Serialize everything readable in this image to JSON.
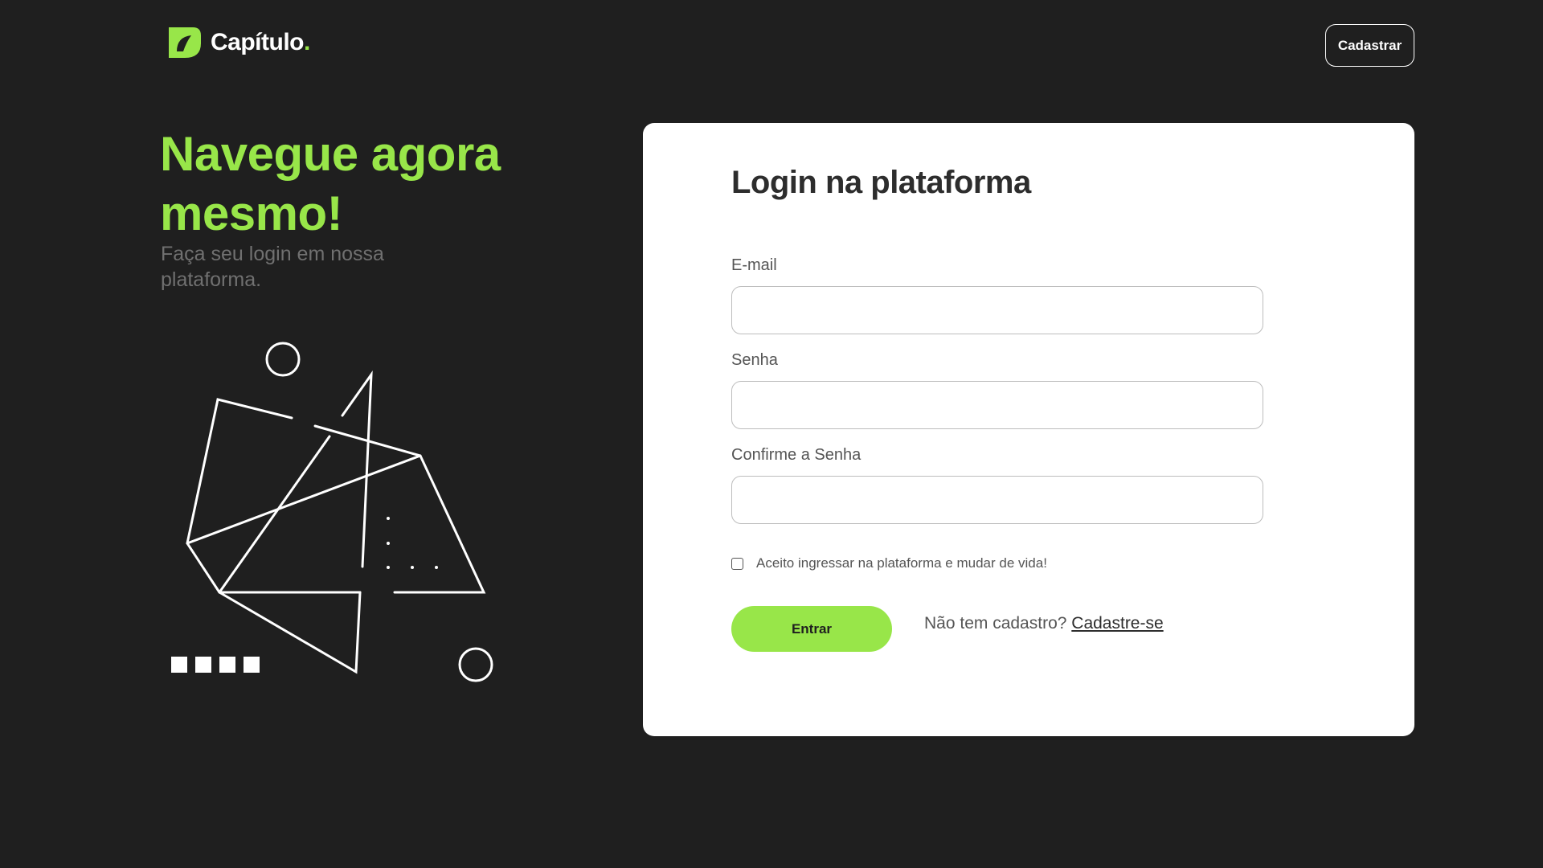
{
  "header": {
    "logo_text": "Capítulo",
    "logo_dot": ".",
    "signup_button": "Cadastrar"
  },
  "hero": {
    "title": "Navegue agora mesmo!",
    "subtitle": "Faça seu login em nossa plataforma."
  },
  "form": {
    "title": "Login na plataforma",
    "fields": [
      {
        "label": "E-mail",
        "value": ""
      },
      {
        "label": "Senha",
        "value": ""
      },
      {
        "label": "Confirme a Senha",
        "value": ""
      }
    ],
    "terms_label": "Aceito ingressar na plataforma e mudar de vida!",
    "terms_checked": false,
    "submit_label": "Entrar",
    "no_account_text": "Não tem cadastro?",
    "signup_link": "Cadastre-se"
  },
  "colors": {
    "background": "#1f1f1f",
    "accent": "#98e649",
    "card": "#ffffff"
  },
  "icons": {
    "logo": "capitulo-logo-icon"
  }
}
